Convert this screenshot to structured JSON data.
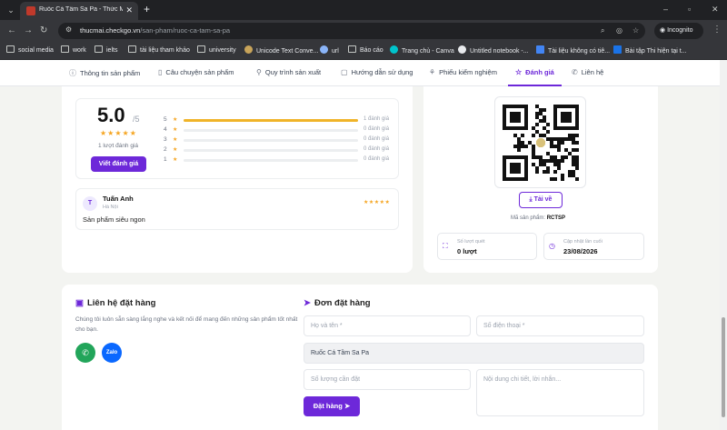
{
  "browser": {
    "tab_title": "Ruốc Cá Tầm Sa Pa - Thức Mai",
    "url_host": "thucmai.checkgo.vn",
    "url_path": "/san-pham/ruoc-ca-tam-sa-pa",
    "incognito_label": "Incognito",
    "bookmarks": [
      {
        "label": "social media",
        "icon": "folder-icon"
      },
      {
        "label": "work",
        "icon": "folder-icon"
      },
      {
        "label": "ielts",
        "icon": "folder-icon"
      },
      {
        "label": "tài liệu tham khảo",
        "icon": "folder-icon"
      },
      {
        "label": "university",
        "icon": "folder-icon"
      },
      {
        "label": "Unicode Text Conve...",
        "icon": "unicode-icon"
      },
      {
        "label": "url",
        "icon": "globe-icon"
      },
      {
        "label": "Báo cáo",
        "icon": "folder-icon"
      },
      {
        "label": "Trang chủ - Canva",
        "icon": "canva-icon"
      },
      {
        "label": "Untitled notebook -...",
        "icon": "notebook-icon"
      },
      {
        "label": "Tài liệu không có tiê...",
        "icon": "docs-icon"
      },
      {
        "label": "Bài tập Thi hiện tại t...",
        "icon": "site-icon"
      }
    ]
  },
  "nav": {
    "items": [
      {
        "label": "Thông tin sản phẩm",
        "icon": "info-icon"
      },
      {
        "label": "Câu chuyện sản phẩm",
        "icon": "book-icon"
      },
      {
        "label": "Quy trình sản xuất",
        "icon": "process-icon"
      },
      {
        "label": "Hướng dẫn sử dụng",
        "icon": "guide-icon"
      },
      {
        "label": "Phiếu kiểm nghiệm",
        "icon": "certificate-icon"
      },
      {
        "label": "Đánh giá",
        "icon": "star-icon"
      },
      {
        "label": "Liên hệ",
        "icon": "phone-icon"
      }
    ],
    "active": "Đánh giá"
  },
  "rating": {
    "score": "5.0",
    "out_of": "/5",
    "stars": "★★★★★",
    "count_text": "1 lượt đánh giá",
    "write_button": "Viết đánh giá",
    "breakdown": [
      {
        "level": "5",
        "count": "1 đánh giá",
        "fraction": 1.0
      },
      {
        "level": "4",
        "count": "0 đánh giá",
        "fraction": 0
      },
      {
        "level": "3",
        "count": "0 đánh giá",
        "fraction": 0
      },
      {
        "level": "2",
        "count": "0 đánh giá",
        "fraction": 0
      },
      {
        "level": "1",
        "count": "0 đánh giá",
        "fraction": 0
      }
    ]
  },
  "review": {
    "initial": "T",
    "name": "Tuấn Anh",
    "location": "Hà Nội",
    "stars": "★★★★★",
    "text": "Sản phẩm siêu ngon"
  },
  "qr": {
    "download_label": "Tải về",
    "product_code_label": "Mã sản phẩm:",
    "product_code": "RCTSP",
    "scans_label": "Số lượt quét",
    "scans_value": "0 lượt",
    "updated_label": "Cập nhật lần cuối",
    "updated_value": "23/08/2026"
  },
  "contact": {
    "title": "Liên hệ đặt hàng",
    "description": "Chúng tôi luôn sẵn sàng lắng nghe và kết nối để mang đến những sản phẩm tốt nhất cho bạn.",
    "zalo_label": "Zalo"
  },
  "order": {
    "title": "Đơn đặt hàng",
    "name_placeholder": "Họ và tên *",
    "phone_placeholder": "Số điện thoại *",
    "product_value": "Ruốc Cá Tầm Sa Pa",
    "quantity_placeholder": "Số lượng cần đặt",
    "message_placeholder": "Nội dung chi tiết, lời nhắn...",
    "submit_label": "Đặt hàng"
  },
  "colors": {
    "accent": "#6d28d9",
    "star": "#f5a623",
    "phone_green": "#22a55a",
    "zalo_blue": "#0a68ff"
  }
}
